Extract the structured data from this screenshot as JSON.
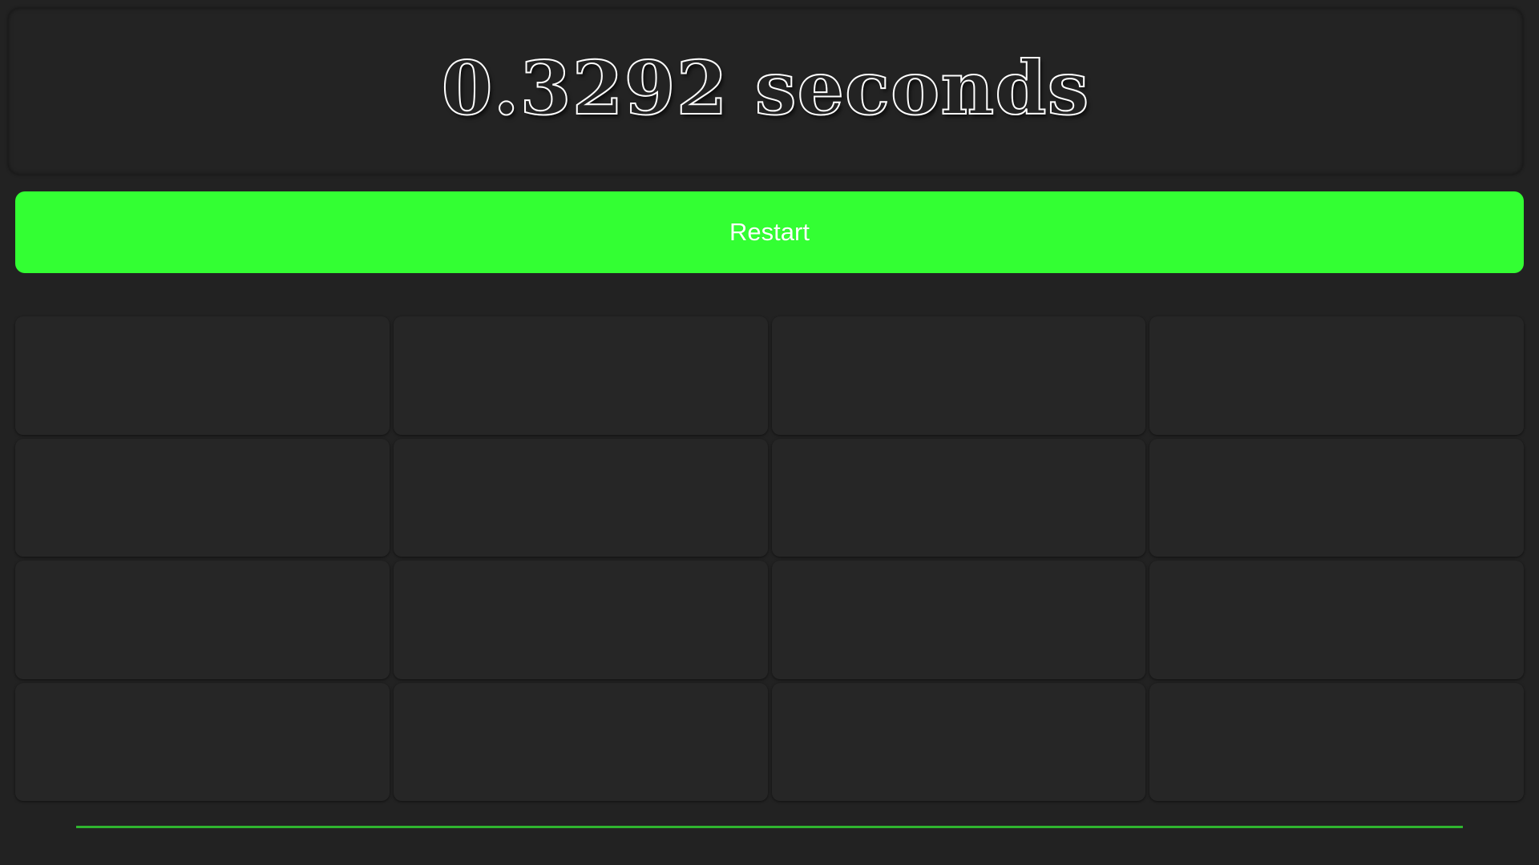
{
  "timer": {
    "text": "0.3292 seconds"
  },
  "restart_button": {
    "label": "Restart",
    "color": "#33ff33"
  },
  "grid": {
    "rows": 4,
    "columns": 4,
    "tiles": [
      {
        "id": 1
      },
      {
        "id": 2
      },
      {
        "id": 3
      },
      {
        "id": 4
      },
      {
        "id": 5
      },
      {
        "id": 6
      },
      {
        "id": 7
      },
      {
        "id": 8
      },
      {
        "id": 9
      },
      {
        "id": 10
      },
      {
        "id": 11
      },
      {
        "id": 12
      },
      {
        "id": 13
      },
      {
        "id": 14
      },
      {
        "id": 15
      },
      {
        "id": 16
      }
    ]
  },
  "progress": {
    "fraction": 1.0,
    "color": "#2fb52f"
  }
}
